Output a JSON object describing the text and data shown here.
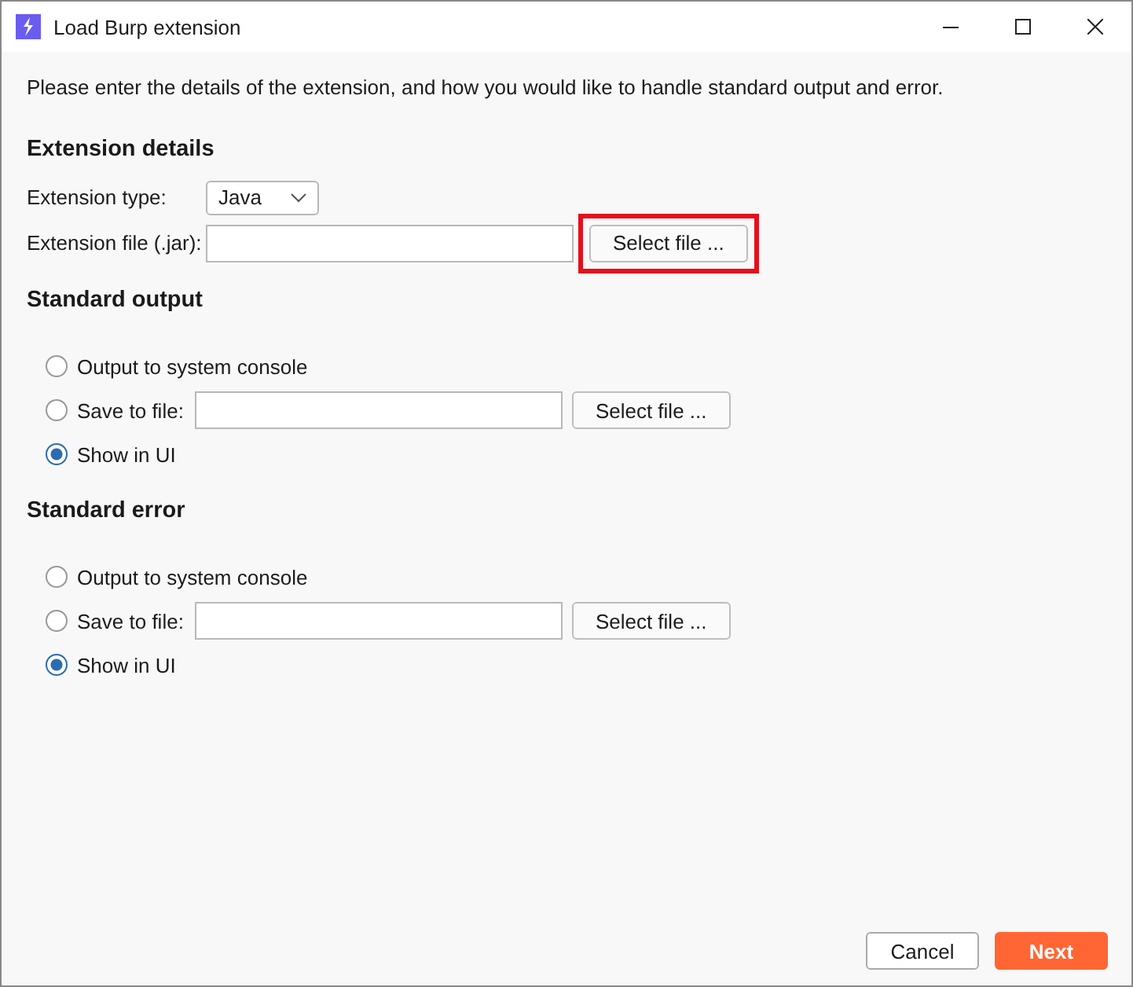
{
  "window": {
    "title": "Load Burp extension"
  },
  "intro": "Please enter the details of the extension, and how you would like to handle standard output and error.",
  "extension_details": {
    "heading": "Extension details",
    "type_label": "Extension type:",
    "type_value": "Java",
    "file_label": "Extension file (.jar):",
    "file_button": {
      "label": "Select file ...",
      "highlighted": true
    }
  },
  "sections": [
    {
      "heading": "Standard output",
      "options": [
        {
          "kind": "radio",
          "label": "Output to system console",
          "selected": false
        },
        {
          "kind": "file",
          "label": "Save to file:",
          "button": "Select file ...",
          "selected": false
        },
        {
          "kind": "radio",
          "label": "Show in UI",
          "selected": true
        }
      ]
    },
    {
      "heading": "Standard error",
      "options": [
        {
          "kind": "radio",
          "label": "Output to system console",
          "selected": false
        },
        {
          "kind": "file",
          "label": "Save to file:",
          "button": "Select file ...",
          "selected": false
        },
        {
          "kind": "radio",
          "label": "Show in UI",
          "selected": true
        }
      ]
    }
  ],
  "buttons": [
    {
      "kind": "secondary",
      "label": "Cancel"
    },
    {
      "kind": "primary",
      "label": "Next"
    }
  ]
}
